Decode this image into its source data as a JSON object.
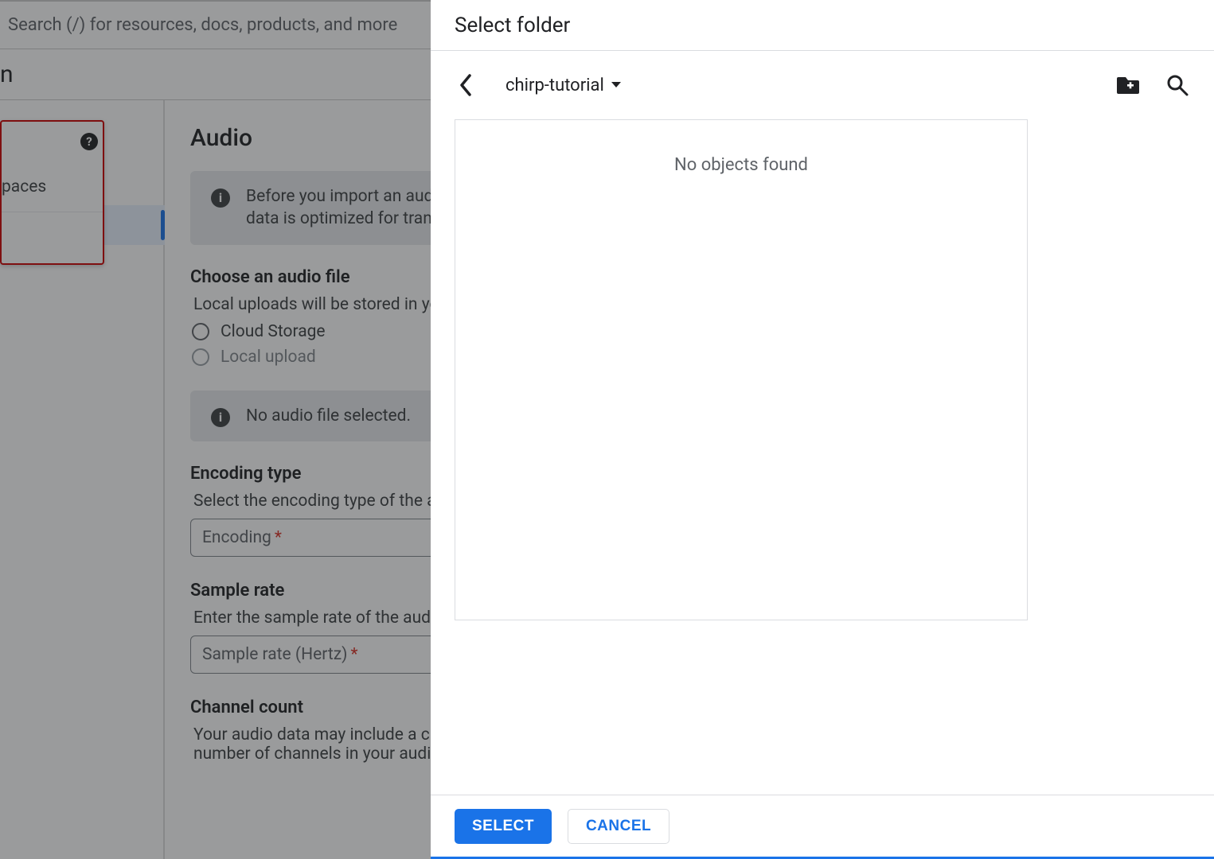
{
  "search": {
    "placeholder": "Search (/) for resources, docs, products, and more"
  },
  "page": {
    "title_suffix": "n"
  },
  "float_menu": {
    "item1": "paces"
  },
  "main": {
    "heading": "Audio",
    "banner1": "Before you import an audio file, read the best practices for providing speech data. This will help you ensure that your speech data is optimized for transcription.",
    "choose_head": "Choose an audio file",
    "choose_sub": "Local uploads will be stored in your specified Cloud Storage location.",
    "radio_cloud": "Cloud Storage",
    "radio_local": "Local upload",
    "banner2": "No audio file selected.",
    "enc_head": "Encoding type",
    "enc_sub": "Select the encoding type of the audio file you're transcribing.",
    "enc_field": "Encoding",
    "rate_head": "Sample rate",
    "rate_sub": "Enter the sample rate of the audio file you're transcribing.",
    "rate_field": "Sample rate (Hertz)",
    "chan_head": "Channel count",
    "chan_sub": "Your audio data may include a channel for each speaker on the recording. Note that the channel count affects pricing . Enter the number of channels in your audio."
  },
  "modal": {
    "title": "Select folder",
    "crumb": "chirp-tutorial",
    "empty": "No objects found",
    "select": "SELECT",
    "cancel": "CANCEL"
  }
}
